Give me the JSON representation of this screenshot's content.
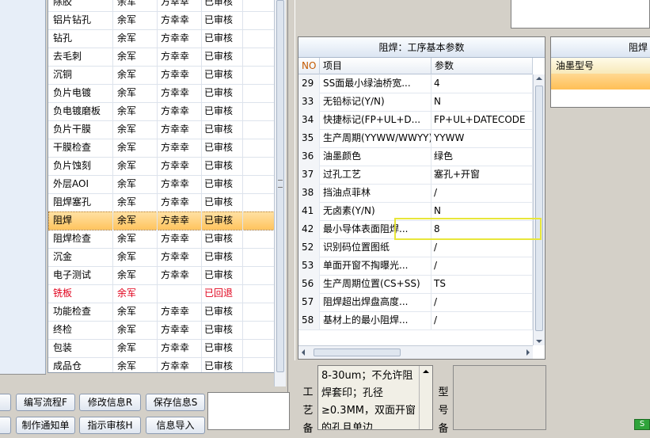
{
  "process_list": {
    "rows": [
      {
        "name": "除胶",
        "person": "余军",
        "approver": "方幸幸",
        "status": "已审核",
        "state": "normal"
      },
      {
        "name": "铝片钻孔",
        "person": "余军",
        "approver": "方幸幸",
        "status": "已审核",
        "state": "normal"
      },
      {
        "name": "钻孔",
        "person": "余军",
        "approver": "方幸幸",
        "status": "已审核",
        "state": "normal"
      },
      {
        "name": "去毛刺",
        "person": "余军",
        "approver": "方幸幸",
        "status": "已审核",
        "state": "normal"
      },
      {
        "name": "沉铜",
        "person": "余军",
        "approver": "方幸幸",
        "status": "已审核",
        "state": "normal"
      },
      {
        "name": "负片电镀",
        "person": "余军",
        "approver": "方幸幸",
        "status": "已审核",
        "state": "normal"
      },
      {
        "name": "负电镀磨板",
        "person": "余军",
        "approver": "方幸幸",
        "status": "已审核",
        "state": "normal"
      },
      {
        "name": "负片干膜",
        "person": "余军",
        "approver": "方幸幸",
        "status": "已审核",
        "state": "normal"
      },
      {
        "name": "干膜检查",
        "person": "余军",
        "approver": "方幸幸",
        "status": "已审核",
        "state": "normal"
      },
      {
        "name": "负片蚀刻",
        "person": "余军",
        "approver": "方幸幸",
        "status": "已审核",
        "state": "normal"
      },
      {
        "name": "外层AOI",
        "person": "余军",
        "approver": "方幸幸",
        "status": "已审核",
        "state": "normal"
      },
      {
        "name": "阻焊塞孔",
        "person": "余军",
        "approver": "方幸幸",
        "status": "已审核",
        "state": "normal"
      },
      {
        "name": "阻焊",
        "person": "余军",
        "approver": "方幸幸",
        "status": "已审核",
        "state": "selected"
      },
      {
        "name": "阻焊检查",
        "person": "余军",
        "approver": "方幸幸",
        "status": "已审核",
        "state": "normal"
      },
      {
        "name": "沉金",
        "person": "余军",
        "approver": "方幸幸",
        "status": "已审核",
        "state": "normal"
      },
      {
        "name": "电子测试",
        "person": "余军",
        "approver": "方幸幸",
        "status": "已审核",
        "state": "normal"
      },
      {
        "name": "铣板",
        "person": "余军",
        "approver": "",
        "status": "已回退",
        "state": "returned"
      },
      {
        "name": "功能检查",
        "person": "余军",
        "approver": "方幸幸",
        "status": "已审核",
        "state": "normal"
      },
      {
        "name": "终检",
        "person": "余军",
        "approver": "方幸幸",
        "status": "已审核",
        "state": "normal"
      },
      {
        "name": "包装",
        "person": "余军",
        "approver": "方幸幸",
        "status": "已审核",
        "state": "normal"
      },
      {
        "name": "成品仓",
        "person": "余军",
        "approver": "方幸幸",
        "status": "已审核",
        "state": "normal"
      }
    ]
  },
  "buttons": {
    "edit_flow": "编写流程F",
    "modify_info": "修改信息R",
    "save_info": "保存信息S",
    "make_notice": "制作通知单",
    "instruction_review": "指示审核H",
    "import_info": "信息导入"
  },
  "params_panel": {
    "title": "阻焊：工序基本参数",
    "col_no": "NO",
    "col_item": "项目",
    "col_param": "参数",
    "rows": [
      {
        "no": "29",
        "item": "SS面最小绿油桥宽...",
        "value": "4"
      },
      {
        "no": "33",
        "item": "无铅标记(Y/N)",
        "value": "N"
      },
      {
        "no": "34",
        "item": "快捷标记(FP+UL+D...",
        "value": "FP+UL+DATECODE"
      },
      {
        "no": "35",
        "item": "生产周期(YYWW/WWYY)",
        "value": "YYWW"
      },
      {
        "no": "36",
        "item": "油墨颜色",
        "value": "绿色"
      },
      {
        "no": "37",
        "item": "过孔工艺",
        "value": "塞孔+开窗"
      },
      {
        "no": "38",
        "item": "挡油点菲林",
        "value": "/"
      },
      {
        "no": "41",
        "item": "无卤素(Y/N)",
        "value": "N"
      },
      {
        "no": "42",
        "item": "最小导体表面阻焊...",
        "value": "8"
      },
      {
        "no": "52",
        "item": "识别码位置图纸",
        "value": "/"
      },
      {
        "no": "53",
        "item": "单面开窗不掏曝光...",
        "value": "/"
      },
      {
        "no": "56",
        "item": "生产周期位置(CS+SS)",
        "value": "TS"
      },
      {
        "no": "57",
        "item": "阻焊超出焊盘高度...",
        "value": "/"
      },
      {
        "no": "58",
        "item": "基材上的最小阻焊...",
        "value": "/"
      }
    ]
  },
  "ink_panel": {
    "title": "阻焊",
    "header": "油墨型号"
  },
  "notes": {
    "label": "工艺备",
    "text": "8-30um；不允许阻焊套印；孔径≥0.3MM，双面开窗的孔且单边",
    "model_label": "型号备"
  },
  "colors": {
    "selected_row": "#ffc45e",
    "returned_text": "#e0001b",
    "focus_box": "#e8e63a"
  }
}
